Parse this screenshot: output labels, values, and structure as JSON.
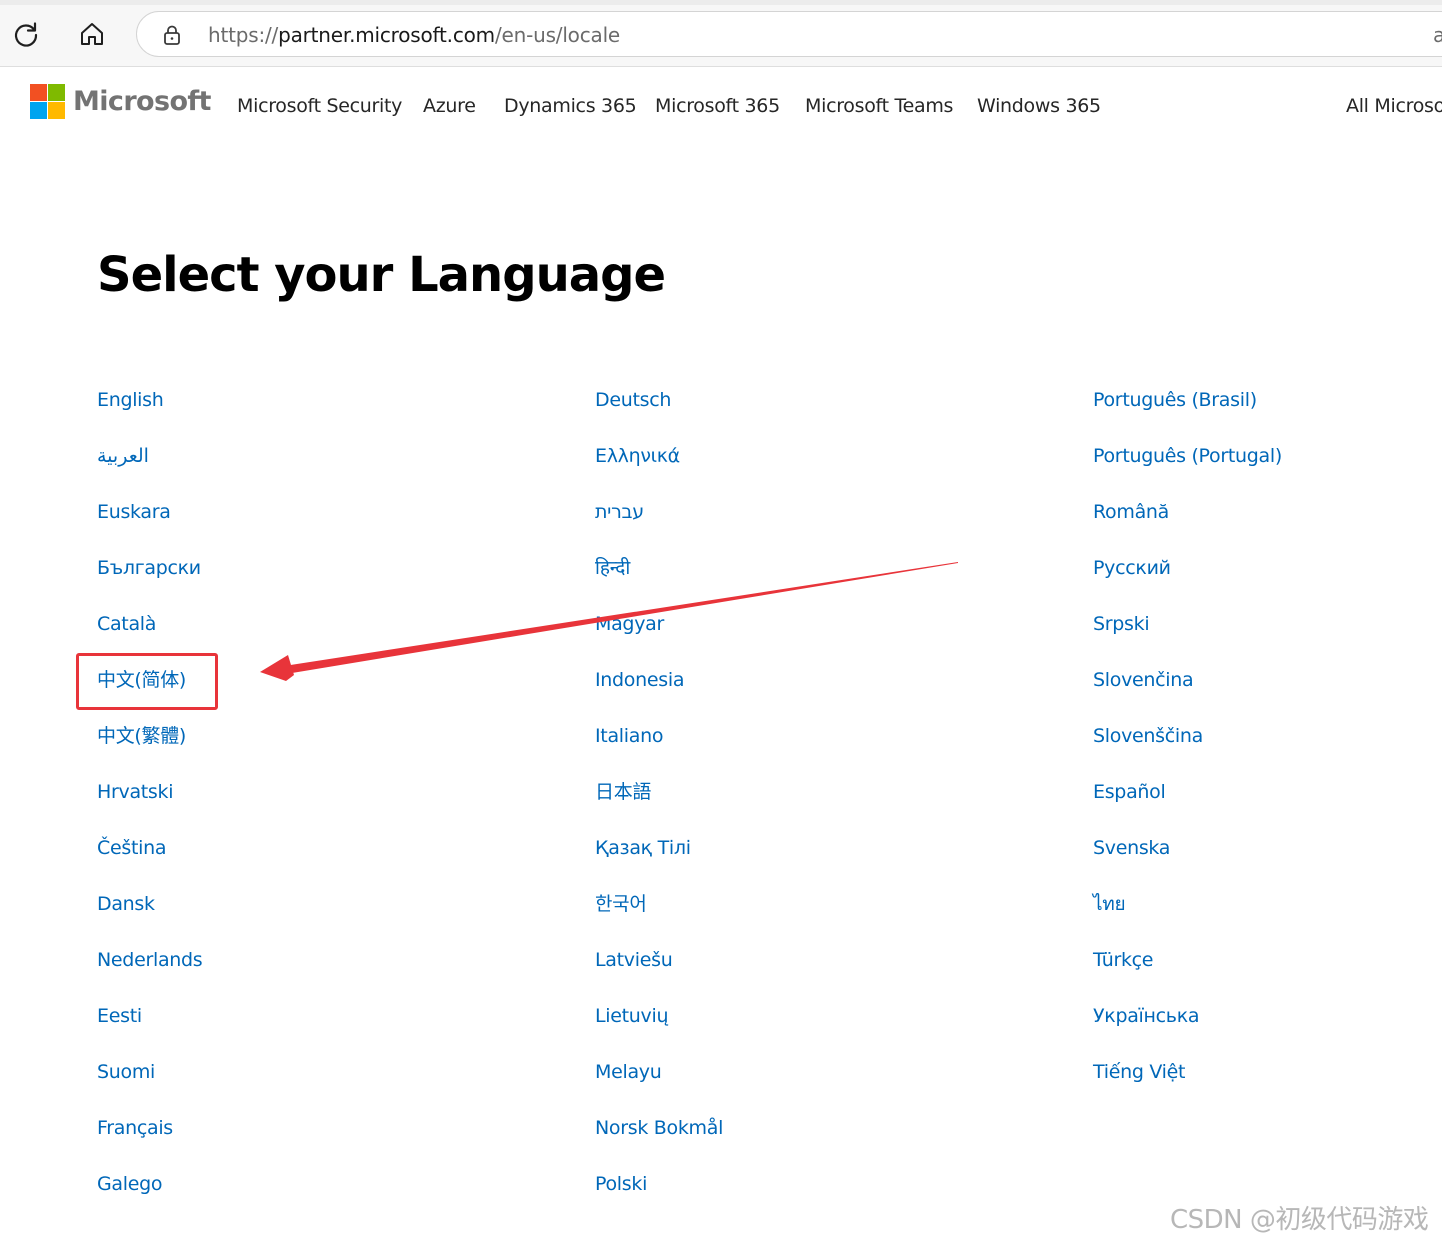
{
  "browser": {
    "url": {
      "scheme": "https://",
      "host": "partner.microsoft.com",
      "path": "/en-us/locale"
    },
    "address_trailing_text": "a"
  },
  "header": {
    "logo_text": "Microsoft",
    "logo_colors": [
      "#f25022",
      "#7fba00",
      "#00a4ef",
      "#ffb900"
    ],
    "nav": [
      "Microsoft Security",
      "Azure",
      "Dynamics 365",
      "Microsoft 365",
      "Microsoft Teams",
      "Windows 365"
    ],
    "all_microsoft": "All Microso"
  },
  "main": {
    "title": "Select your Language",
    "columns": [
      [
        "English",
        "العربية",
        "Euskara",
        "Български",
        "Català",
        "中文(简体)",
        "中文(繁體)",
        "Hrvatski",
        "Čeština",
        "Dansk",
        "Nederlands",
        "Eesti",
        "Suomi",
        "Français",
        "Galego"
      ],
      [
        "Deutsch",
        "Ελληνικά",
        "עברית",
        "हिन्दी",
        "Magyar",
        "Indonesia",
        "Italiano",
        "日本語",
        "Қазақ Тілі",
        "한국어",
        "Latviešu",
        "Lietuvių",
        "Melayu",
        "Norsk Bokmål",
        "Polski"
      ],
      [
        "Português (Brasil)",
        "Português (Portugal)",
        "Română",
        "Русский",
        "Srpski",
        "Slovenčina",
        "Slovenščina",
        "Español",
        "Svenska",
        "ไทย",
        "Türkçe",
        "Українська",
        "Tiếng Việt"
      ]
    ],
    "link_color": "#0067b8"
  },
  "annotation": {
    "color": "#e8343a"
  },
  "watermark": "CSDN @初级代码游戏"
}
